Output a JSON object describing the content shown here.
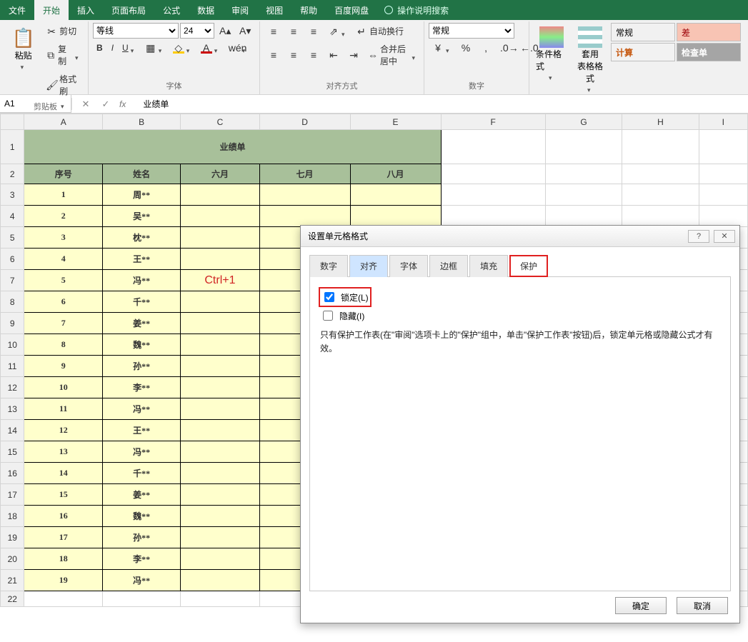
{
  "menu": {
    "tabs": [
      "文件",
      "开始",
      "插入",
      "页面布局",
      "公式",
      "数据",
      "审阅",
      "视图",
      "帮助",
      "百度网盘"
    ],
    "active_index": 1,
    "tell_me": "操作说明搜索"
  },
  "ribbon": {
    "clipboard": {
      "label": "剪贴板",
      "paste": "粘贴",
      "cut": "剪切",
      "copy": "复制",
      "format_painter": "格式刷"
    },
    "font": {
      "label": "字体",
      "name": "等线",
      "size": "24"
    },
    "alignment": {
      "label": "对齐方式",
      "wrap": "自动换行",
      "merge": "合并后居中"
    },
    "number": {
      "label": "数字",
      "format": "常规"
    },
    "styles": {
      "cond": "条件格式",
      "table": "套用\n表格格式",
      "g_normal": "常规",
      "g_calc": "计算",
      "g_bad": "差",
      "g_check": "检查单"
    }
  },
  "formula_bar": {
    "cell_ref": "A1",
    "value": "业绩单"
  },
  "columns": [
    "A",
    "B",
    "C",
    "D",
    "E",
    "F",
    "G",
    "H",
    "I"
  ],
  "row_count": 22,
  "sheet": {
    "title": "业绩单",
    "headers": [
      "序号",
      "姓名",
      "六月",
      "七月",
      "八月"
    ],
    "shortcut_overlay": "Ctrl+1",
    "rows": [
      {
        "n": "1",
        "name": "周**"
      },
      {
        "n": "2",
        "name": "吴**"
      },
      {
        "n": "3",
        "name": "枕**"
      },
      {
        "n": "4",
        "name": "王**"
      },
      {
        "n": "5",
        "name": "冯**"
      },
      {
        "n": "6",
        "name": "千**"
      },
      {
        "n": "7",
        "name": "姜**"
      },
      {
        "n": "8",
        "name": "魏**"
      },
      {
        "n": "9",
        "name": "孙**"
      },
      {
        "n": "10",
        "name": "李**"
      },
      {
        "n": "11",
        "name": "冯**"
      },
      {
        "n": "12",
        "name": "王**"
      },
      {
        "n": "13",
        "name": "冯**"
      },
      {
        "n": "14",
        "name": "千**"
      },
      {
        "n": "15",
        "name": "姜**"
      },
      {
        "n": "16",
        "name": "魏**"
      },
      {
        "n": "17",
        "name": "孙**"
      },
      {
        "n": "18",
        "name": "李**"
      },
      {
        "n": "19",
        "name": "冯**"
      }
    ]
  },
  "dialog": {
    "title": "设置单元格格式",
    "tabs": [
      "数字",
      "对齐",
      "字体",
      "边框",
      "填充",
      "保护"
    ],
    "active_tab_index": 5,
    "blue_tab_index": 1,
    "lock_label": "锁定(L)",
    "lock_checked": true,
    "hide_label": "隐藏(I)",
    "hide_checked": false,
    "note": "只有保护工作表(在\"审阅\"选项卡上的\"保护\"组中，单击\"保护工作表\"按钮)后，锁定单元格或隐藏公式才有效。",
    "ok": "确定",
    "cancel": "取消"
  }
}
